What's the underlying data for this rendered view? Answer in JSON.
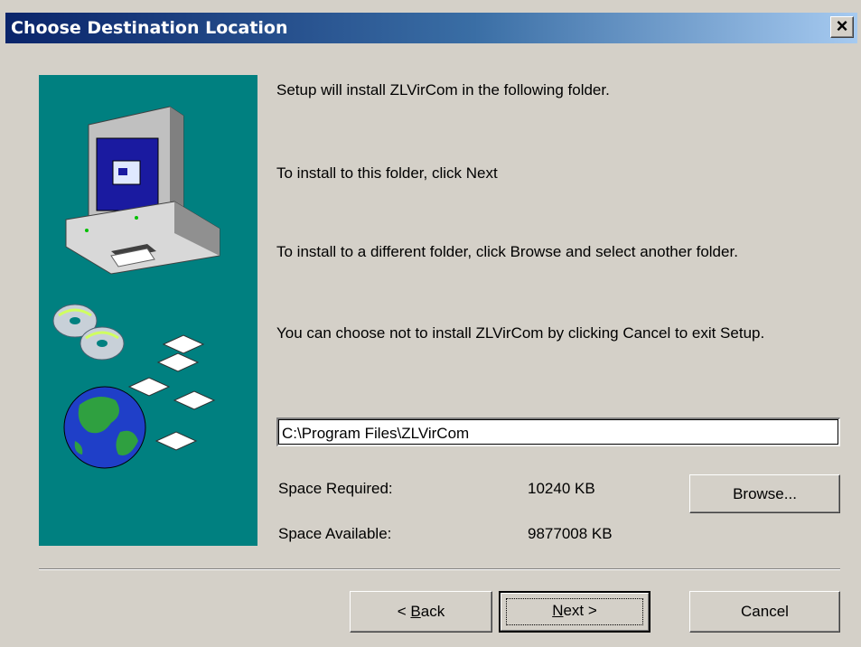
{
  "window": {
    "title": "Choose Destination Location",
    "close_label": "×"
  },
  "body": {
    "line1": "Setup will install ZLVirCom in the following folder.",
    "line2": "To install to this folder, click Next",
    "line3": "To install to a different folder, click Browse and select another folder.",
    "line4": "You can choose not to install ZLVirCom by clicking Cancel to exit Setup."
  },
  "destination": {
    "path": "C:\\Program Files\\ZLVirCom"
  },
  "space": {
    "required_label": "Space Required:",
    "required_value": "10240 KB",
    "available_label": "Space Available:",
    "available_value": "9877008 KB"
  },
  "buttons": {
    "browse": "Browse...",
    "back_prefix": "< ",
    "back_accel": "B",
    "back_rest": "ack",
    "next_accel": "N",
    "next_rest": "ext >",
    "cancel": "Cancel"
  },
  "icons": [
    "computer-icon",
    "cd-disc-icon",
    "floppy-disk-icon",
    "globe-icon"
  ],
  "colors": {
    "title_start": "#0a246a",
    "title_end": "#a6caf0",
    "panel": "#008080",
    "face": "#d4d0c8"
  }
}
